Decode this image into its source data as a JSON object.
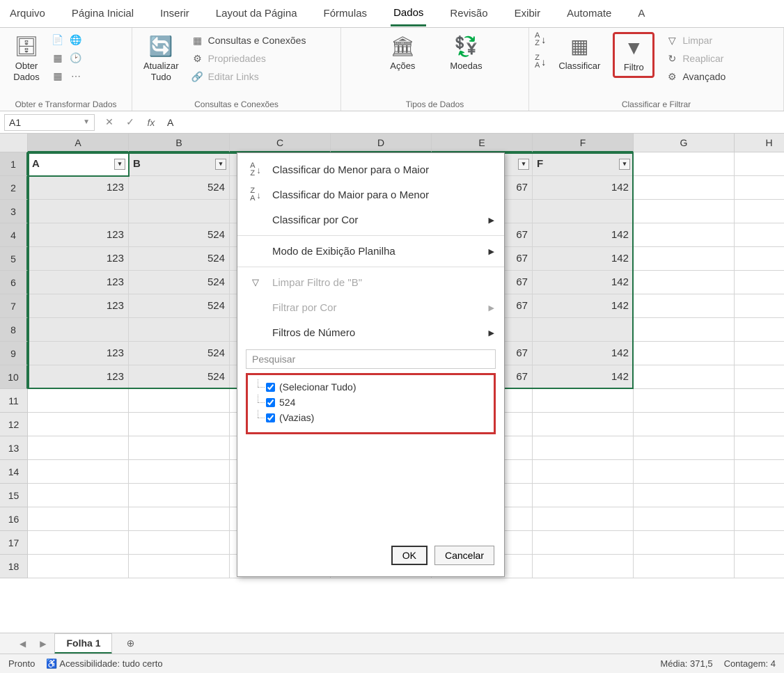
{
  "tabs": {
    "arquivo": "Arquivo",
    "pagina_inicial": "Página Inicial",
    "inserir": "Inserir",
    "layout": "Layout da Página",
    "formulas": "Fórmulas",
    "dados": "Dados",
    "revisao": "Revisão",
    "exibir": "Exibir",
    "automate": "Automate",
    "ajuda": "A"
  },
  "ribbon": {
    "obter_dados": "Obter\nDados",
    "grupo_obter": "Obter e Transformar Dados",
    "atualizar_tudo": "Atualizar\nTudo",
    "consultas_conexoes": "Consultas e Conexões",
    "propriedades": "Propriedades",
    "editar_links": "Editar Links",
    "grupo_consultas": "Consultas e Conexões",
    "acoes": "Ações",
    "moedas": "Moedas",
    "grupo_tipos": "Tipos de Dados",
    "classificar": "Classificar",
    "filtro": "Filtro",
    "limpar": "Limpar",
    "reaplicar": "Reaplicar",
    "avancado": "Avançado",
    "grupo_classificar": "Classificar e Filtrar"
  },
  "formula_bar": {
    "cell_ref": "A1",
    "value": "A"
  },
  "columns": [
    "A",
    "B",
    "C",
    "D",
    "E",
    "F",
    "G",
    "H"
  ],
  "headers": [
    "A",
    "B",
    "",
    "",
    "",
    "F"
  ],
  "data_rows": [
    [
      "123",
      "524",
      "",
      "",
      "67",
      "142"
    ],
    [
      "",
      "",
      "",
      "",
      "",
      ""
    ],
    [
      "123",
      "524",
      "",
      "",
      "67",
      "142"
    ],
    [
      "123",
      "524",
      "",
      "",
      "67",
      "142"
    ],
    [
      "123",
      "524",
      "",
      "",
      "67",
      "142"
    ],
    [
      "123",
      "524",
      "",
      "",
      "67",
      "142"
    ],
    [
      "",
      "",
      "",
      "",
      "",
      ""
    ],
    [
      "123",
      "524",
      "",
      "",
      "67",
      "142"
    ],
    [
      "123",
      "524",
      "",
      "",
      "67",
      "142"
    ]
  ],
  "filter_menu": {
    "sort_asc": "Classificar do Menor para o Maior",
    "sort_desc": "Classificar do Maior para o Menor",
    "sort_color": "Classificar por Cor",
    "sheet_view": "Modo de Exibição Planilha",
    "clear_filter": "Limpar Filtro de \"B\"",
    "filter_color": "Filtrar por Cor",
    "number_filters": "Filtros de Número",
    "search_placeholder": "Pesquisar",
    "select_all": "(Selecionar Tudo)",
    "val_524": "524",
    "blanks": "(Vazias)",
    "ok": "OK",
    "cancel": "Cancelar"
  },
  "sheet_tabs": {
    "folha1": "Folha 1"
  },
  "status": {
    "pronto": "Pronto",
    "acessibilidade": "Acessibilidade: tudo certo",
    "media": "Média: 371,5",
    "contagem": "Contagem: 4"
  }
}
